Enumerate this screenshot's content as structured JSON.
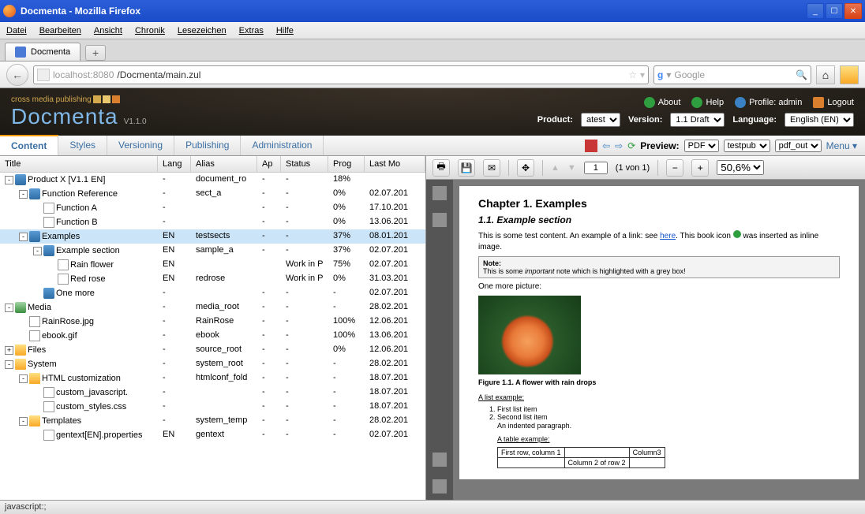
{
  "window": {
    "title": "Docmenta - Mozilla Firefox"
  },
  "firefox": {
    "menus": [
      "Datei",
      "Bearbeiten",
      "Ansicht",
      "Chronik",
      "Lesezeichen",
      "Extras",
      "Hilfe"
    ],
    "tab_title": "Docmenta",
    "url_host": "localhost:8080",
    "url_path": "/Docmenta/main.zul",
    "search_placeholder": "Google",
    "status": "javascript:;"
  },
  "header": {
    "tagline": "cross media publishing",
    "logo": "Docmenta",
    "version": "V1.1.0",
    "links": {
      "about": "About",
      "help": "Help",
      "profile": "Profile: admin",
      "logout": "Logout"
    },
    "selectors": {
      "product_label": "Product:",
      "product": "atest",
      "version_label": "Version:",
      "version": "1.1 Draft",
      "language_label": "Language:",
      "language": "English (EN)"
    }
  },
  "tabs": {
    "content": "Content",
    "styles": "Styles",
    "versioning": "Versioning",
    "publishing": "Publishing",
    "admin": "Administration"
  },
  "toolbar": {
    "preview_label": "Preview:",
    "preview_type": "PDF",
    "preview_pub": "testpub",
    "preview_out": "pdf_out",
    "menu": "Menu"
  },
  "tree": {
    "columns": {
      "title": "Title",
      "lang": "Lang",
      "alias": "Alias",
      "ap": "Ap",
      "status": "Status",
      "prog": "Prog",
      "mod": "Last Mo"
    },
    "rows": [
      {
        "indent": 0,
        "toggle": "-",
        "icon": "book",
        "title": "Product X [V1.1 EN]",
        "lang": "-",
        "alias": "document_ro",
        "ap": "-",
        "status": "-",
        "prog": "18%",
        "mod": ""
      },
      {
        "indent": 1,
        "toggle": "-",
        "icon": "book",
        "title": "Function Reference",
        "lang": "-",
        "alias": "sect_a",
        "ap": "-",
        "status": "-",
        "prog": "0%",
        "mod": "02.07.201"
      },
      {
        "indent": 2,
        "toggle": "",
        "icon": "doc",
        "title": "Function A",
        "lang": "-",
        "alias": "",
        "ap": "-",
        "status": "-",
        "prog": "0%",
        "mod": "17.10.201"
      },
      {
        "indent": 2,
        "toggle": "",
        "icon": "doc",
        "title": "Function B",
        "lang": "-",
        "alias": "",
        "ap": "-",
        "status": "-",
        "prog": "0%",
        "mod": "13.06.201"
      },
      {
        "indent": 1,
        "toggle": "-",
        "icon": "book",
        "title": "Examples",
        "lang": "EN",
        "alias": "testsects",
        "ap": "-",
        "status": "-",
        "prog": "37%",
        "mod": "08.01.201",
        "selected": true
      },
      {
        "indent": 2,
        "toggle": "-",
        "icon": "book",
        "title": "Example section",
        "lang": "EN",
        "alias": "sample_a",
        "ap": "-",
        "status": "-",
        "prog": "37%",
        "mod": "02.07.201"
      },
      {
        "indent": 3,
        "toggle": "",
        "icon": "doc",
        "title": "Rain flower",
        "lang": "EN",
        "alias": "",
        "ap": "",
        "status": "Work in P",
        "prog": "75%",
        "mod": "02.07.201"
      },
      {
        "indent": 3,
        "toggle": "",
        "icon": "doc",
        "title": "Red rose",
        "lang": "EN",
        "alias": "redrose",
        "ap": "",
        "status": "Work in P",
        "prog": "0%",
        "mod": "31.03.201"
      },
      {
        "indent": 2,
        "toggle": "",
        "icon": "book",
        "title": "One more",
        "lang": "-",
        "alias": "",
        "ap": "-",
        "status": "-",
        "prog": "-",
        "mod": "02.07.201"
      },
      {
        "indent": 0,
        "toggle": "-",
        "icon": "media",
        "title": "Media",
        "lang": "-",
        "alias": "media_root",
        "ap": "-",
        "status": "-",
        "prog": "-",
        "mod": "28.02.201"
      },
      {
        "indent": 1,
        "toggle": "",
        "icon": "doc",
        "title": "RainRose.jpg",
        "lang": "-",
        "alias": "RainRose",
        "ap": "-",
        "status": "-",
        "prog": "100%",
        "mod": "12.06.201"
      },
      {
        "indent": 1,
        "toggle": "",
        "icon": "doc",
        "title": "ebook.gif",
        "lang": "-",
        "alias": "ebook",
        "ap": "-",
        "status": "-",
        "prog": "100%",
        "mod": "13.06.201"
      },
      {
        "indent": 0,
        "toggle": "+",
        "icon": "folder",
        "title": "Files",
        "lang": "-",
        "alias": "source_root",
        "ap": "-",
        "status": "-",
        "prog": "0%",
        "mod": "12.06.201"
      },
      {
        "indent": 0,
        "toggle": "-",
        "icon": "folder",
        "title": "System",
        "lang": "-",
        "alias": "system_root",
        "ap": "-",
        "status": "-",
        "prog": "-",
        "mod": "28.02.201"
      },
      {
        "indent": 1,
        "toggle": "-",
        "icon": "folder",
        "title": "HTML customization",
        "lang": "-",
        "alias": "htmlconf_fold",
        "ap": "-",
        "status": "-",
        "prog": "-",
        "mod": "18.07.201"
      },
      {
        "indent": 2,
        "toggle": "",
        "icon": "doc",
        "title": "custom_javascript.",
        "lang": "-",
        "alias": "",
        "ap": "-",
        "status": "-",
        "prog": "-",
        "mod": "18.07.201"
      },
      {
        "indent": 2,
        "toggle": "",
        "icon": "doc",
        "title": "custom_styles.css",
        "lang": "-",
        "alias": "",
        "ap": "-",
        "status": "-",
        "prog": "-",
        "mod": "18.07.201"
      },
      {
        "indent": 1,
        "toggle": "-",
        "icon": "folder",
        "title": "Templates",
        "lang": "-",
        "alias": "system_temp",
        "ap": "-",
        "status": "-",
        "prog": "-",
        "mod": "28.02.201"
      },
      {
        "indent": 2,
        "toggle": "",
        "icon": "doc",
        "title": "gentext[EN].properties",
        "lang": "EN",
        "alias": "gentext",
        "ap": "-",
        "status": "-",
        "prog": "-",
        "mod": "02.07.201"
      }
    ]
  },
  "pdf": {
    "page_input": "1",
    "page_of": "(1 von 1)",
    "zoom": "50,6%",
    "doc": {
      "h2": "Chapter 1. Examples",
      "h3": "1.1. Example section",
      "p1a": "This is some test content. An example of a link: see ",
      "p1link": "here",
      "p1b": ". This book icon ",
      "p1c": " was inserted as inline image.",
      "note_title": "Note:",
      "note_body_a": "This is some ",
      "note_body_em": "important",
      "note_body_b": " note which is highlighted with a grey box!",
      "p2": "One more picture:",
      "figcap": "Figure 1.1. A flower with rain drops",
      "listlabel": "A list example:",
      "li1": "First list item",
      "li2": "Second list item",
      "indented": "An indented paragraph.",
      "tablelabel": "A table example:",
      "t11": "First row, column 1",
      "t12": "",
      "t13": "Column3",
      "t21": "",
      "t22": "Column 2 of row 2",
      "t23": ""
    }
  }
}
